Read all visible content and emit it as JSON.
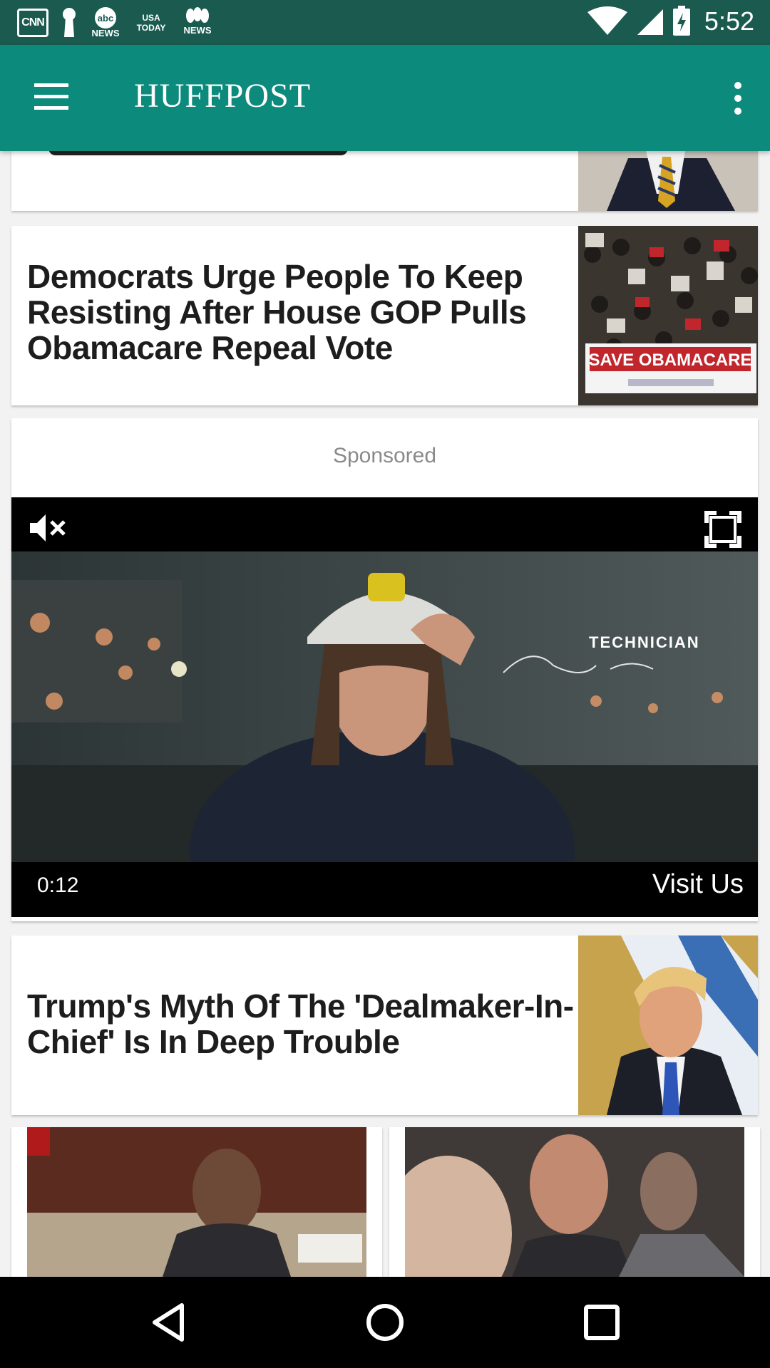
{
  "status_bar": {
    "notifications": [
      "CNN",
      "USA TODAY",
      "NEWS",
      "NEWS"
    ],
    "time": "5:52"
  },
  "toolbar": {
    "logo": "HUFFPOST",
    "menu_icon": "hamburger-menu-icon",
    "overflow_icon": "more-vert-icon"
  },
  "feed": {
    "story_1": {
      "headline": "Democrats Urge People To Keep Resisting After House GOP Pulls Obamacare Repeal Vote",
      "image_text": "SAVE OBAMACARE"
    },
    "ad": {
      "label": "Sponsored",
      "video_overlay": "TECHNICIAN",
      "time": "0:12",
      "cta": "Visit Us"
    },
    "story_2": {
      "headline": "Trump's Myth Of The 'Dealmaker-In-Chief' Is In Deep Trouble"
    }
  },
  "colors": {
    "status_bar": "#1a5a4f",
    "toolbar": "#0c8a7c",
    "background": "#f2f2f2"
  }
}
